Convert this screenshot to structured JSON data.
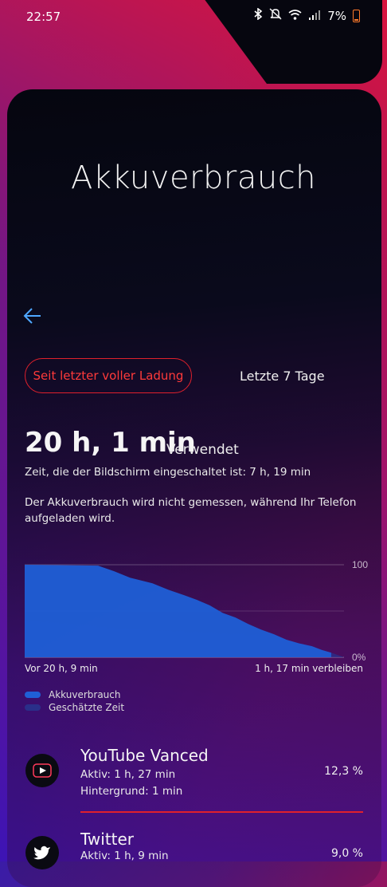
{
  "status": {
    "time": "22:57",
    "battery_percent": "7%",
    "icons": [
      "bluetooth-icon",
      "mute-icon",
      "wifi-icon",
      "signal-icon",
      "battery-icon"
    ]
  },
  "header": {
    "title": "Akkuverbrauch"
  },
  "tabs": {
    "active": "Seit letzter voller Ladung",
    "inactive": "Letzte 7 Tage"
  },
  "summary": {
    "used_time": "20 h, 1 min",
    "used_label": "Verwendet",
    "screen_on": "Zeit, die der Bildschirm eingeschaltet ist: 7 h, 19 min",
    "note": "Der Akkuverbrauch wird nicht gemessen, während Ihr Telefon aufgeladen wird."
  },
  "chart_data": {
    "type": "area",
    "ylim": [
      0,
      100
    ],
    "y_tick_labels": [
      "100",
      "0%"
    ],
    "x_start_label": "Vor 20 h, 9 min",
    "x_end_label": "1 h, 17 min verbleiben",
    "series": [
      {
        "name": "Akkuverbrauch",
        "color": "#1f5fd6",
        "x": [
          0,
          0.23,
          0.28,
          0.33,
          0.4,
          0.45,
          0.5,
          0.54,
          0.58,
          0.62,
          0.66,
          0.7,
          0.74,
          0.78,
          0.82,
          0.86,
          0.9,
          0.93,
          0.96
        ],
        "values": [
          100,
          99,
          93,
          86,
          80,
          73,
          67,
          62,
          56,
          48,
          43,
          36,
          30,
          25,
          19,
          15,
          12,
          8,
          5
        ]
      },
      {
        "name": "Geschätzte Zeit",
        "color": "#2a2f8a",
        "x": [
          0.96,
          1.0
        ],
        "values": [
          5,
          0
        ]
      }
    ]
  },
  "apps": [
    {
      "name": "YouTube Vanced",
      "active": "Aktiv: 1 h, 27 min",
      "background": "Hintergrund: 1 min",
      "percent": "12,3 %",
      "icon": "youtube-icon"
    },
    {
      "name": "Twitter",
      "active": "Aktiv: 1 h, 9 min",
      "percent": "9,0 %",
      "icon": "twitter-bird-icon"
    }
  ]
}
